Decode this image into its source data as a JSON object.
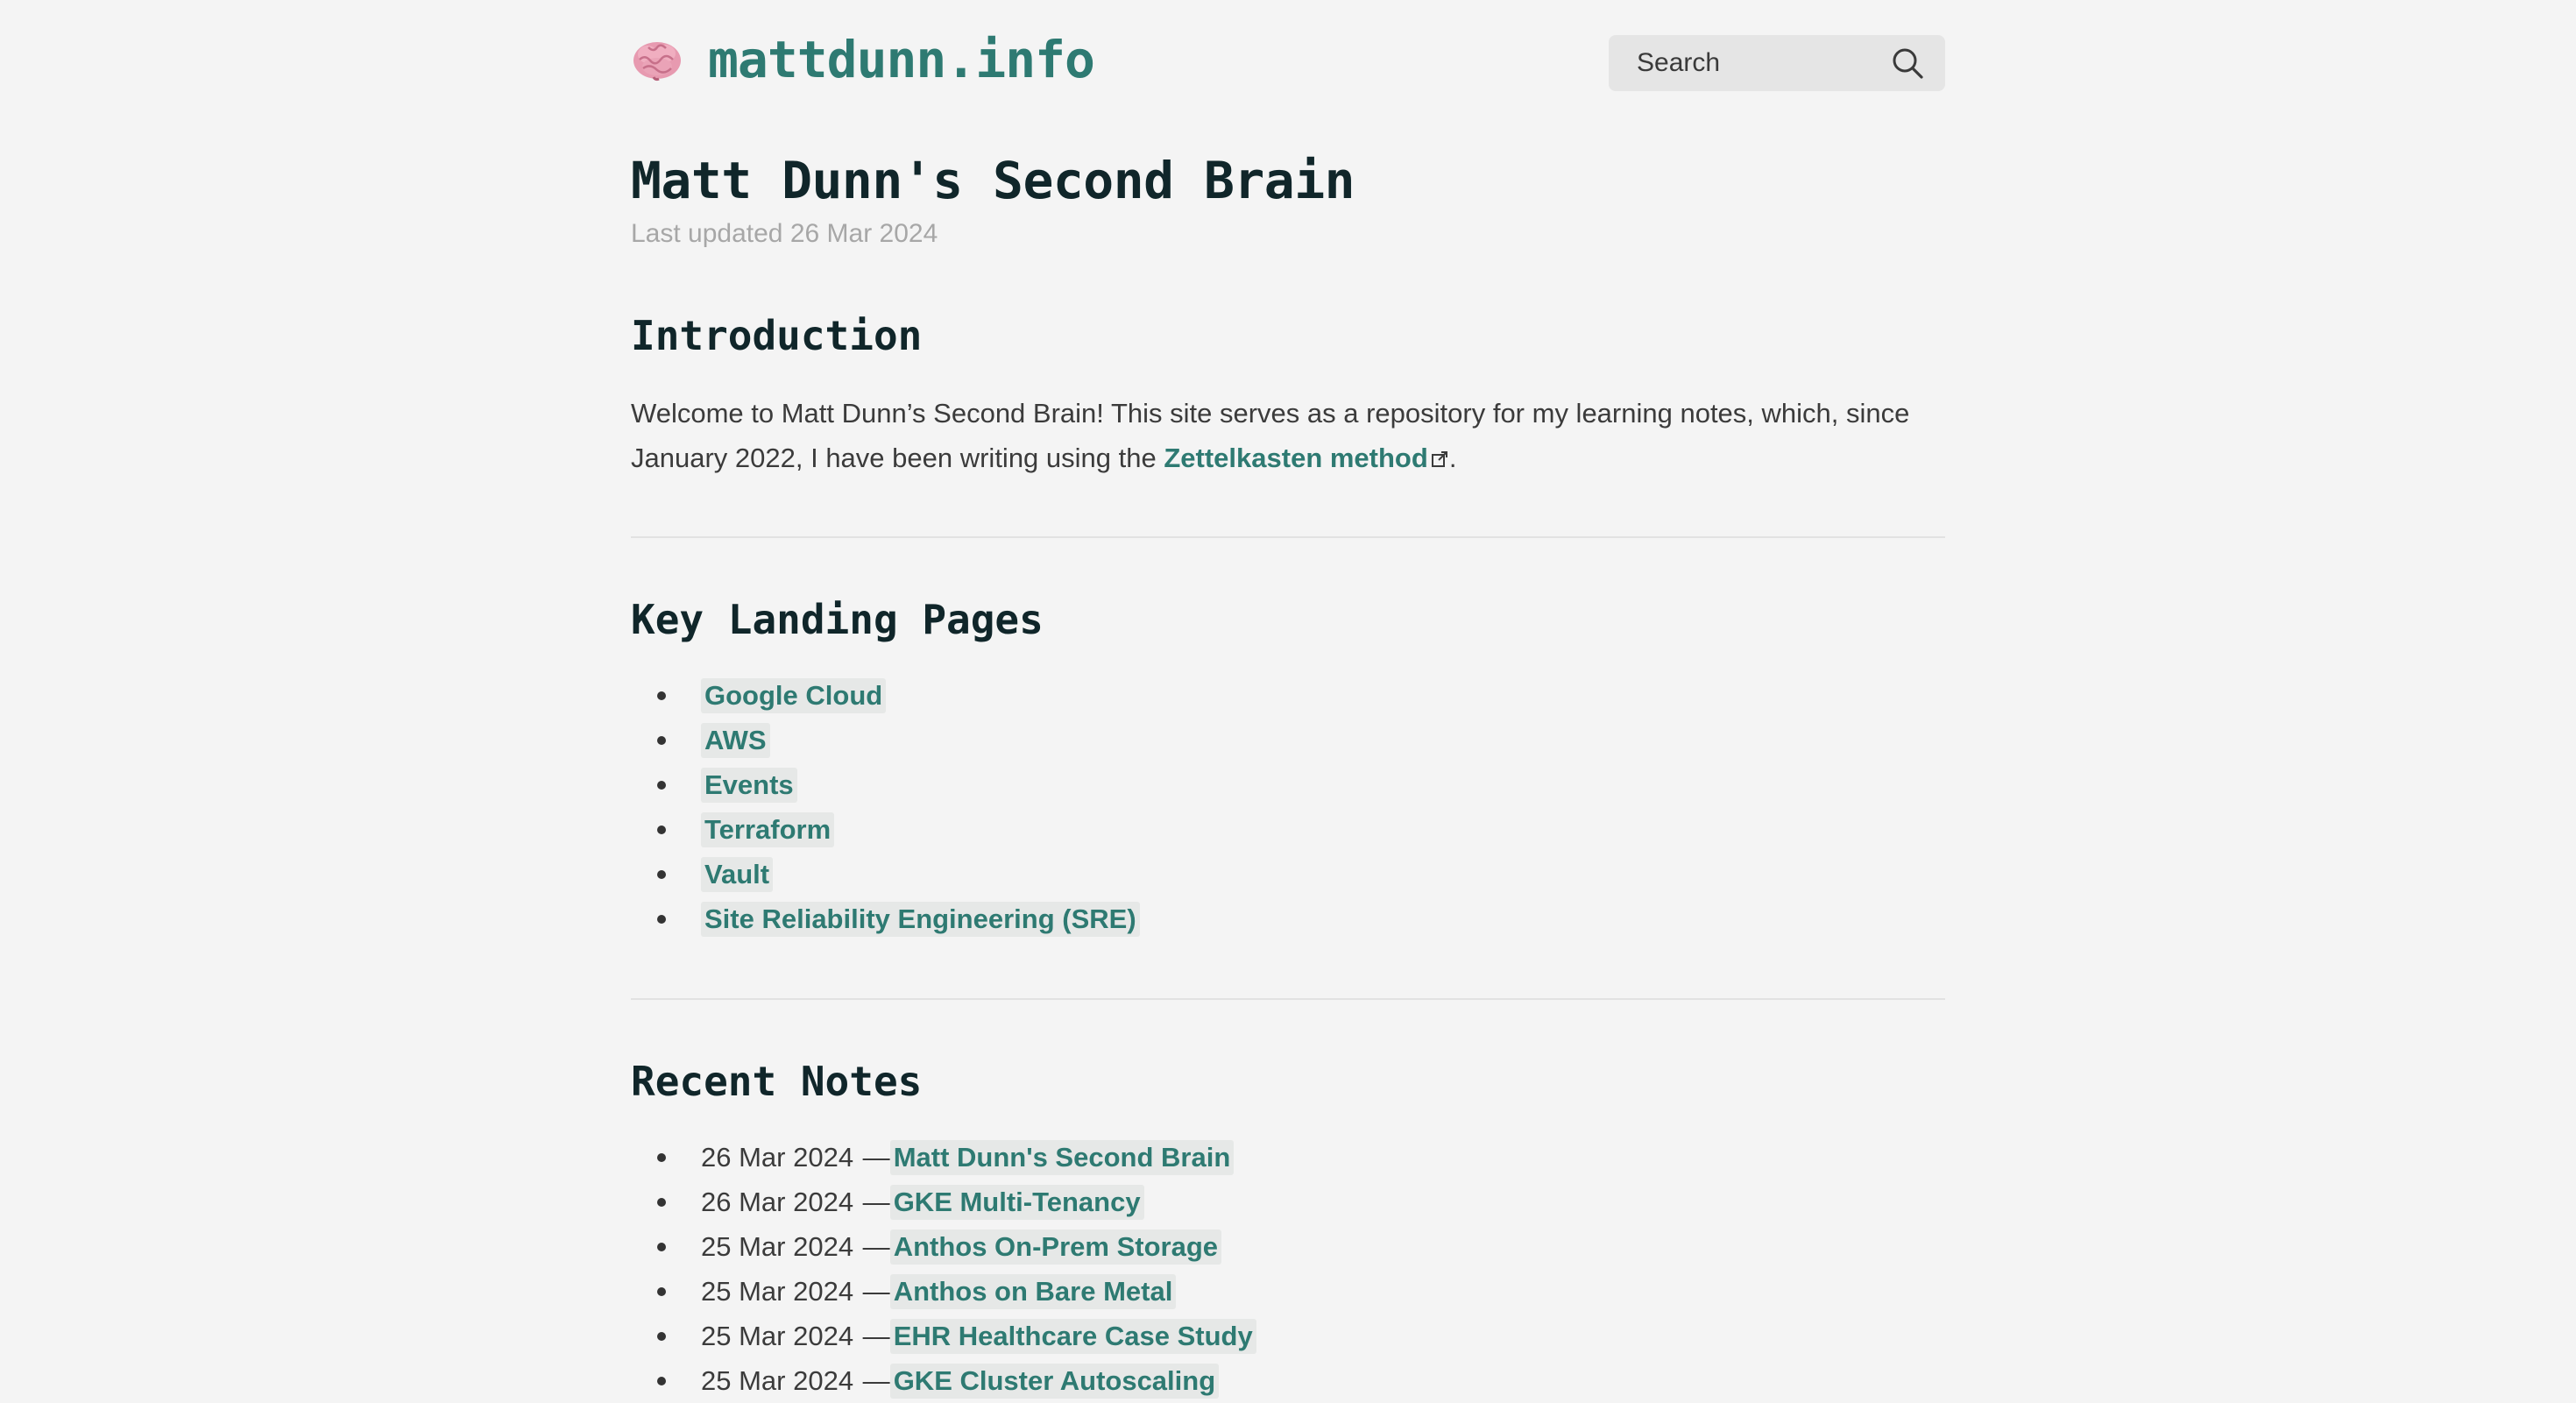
{
  "site": {
    "icon": "brain-icon",
    "title": "mattdunn.info"
  },
  "search": {
    "placeholder": "Search",
    "icon": "search-icon"
  },
  "page": {
    "title": "Matt Dunn's Second Brain",
    "updated": "Last updated 26 Mar 2024"
  },
  "introduction": {
    "heading": "Introduction",
    "text_before_link": "Welcome to Matt Dunn’s Second Brain! This site serves as a repository for my learning notes, which, since January 2022, I have been writing using the ",
    "link_label": "Zettelkasten method",
    "text_after_link": "."
  },
  "landing_pages": {
    "heading": "Key Landing Pages",
    "items": [
      {
        "label": "Google Cloud"
      },
      {
        "label": "AWS"
      },
      {
        "label": "Events"
      },
      {
        "label": "Terraform"
      },
      {
        "label": "Vault"
      },
      {
        "label": "Site Reliability Engineering (SRE)"
      }
    ]
  },
  "recent_notes": {
    "heading": "Recent Notes",
    "separator": " —",
    "items": [
      {
        "date": "26 Mar 2024",
        "title": "Matt Dunn's Second Brain"
      },
      {
        "date": "26 Mar 2024",
        "title": "GKE Multi-Tenancy"
      },
      {
        "date": "25 Mar 2024",
        "title": "Anthos On-Prem Storage"
      },
      {
        "date": "25 Mar 2024",
        "title": "Anthos on Bare Metal"
      },
      {
        "date": "25 Mar 2024",
        "title": "EHR Healthcare Case Study"
      },
      {
        "date": "25 Mar 2024",
        "title": "GKE Cluster Autoscaling"
      }
    ]
  },
  "colors": {
    "accent": "#2e7a72",
    "heading": "#10262a",
    "background": "#f4f4f4",
    "link_background": "#e6e8e7"
  }
}
